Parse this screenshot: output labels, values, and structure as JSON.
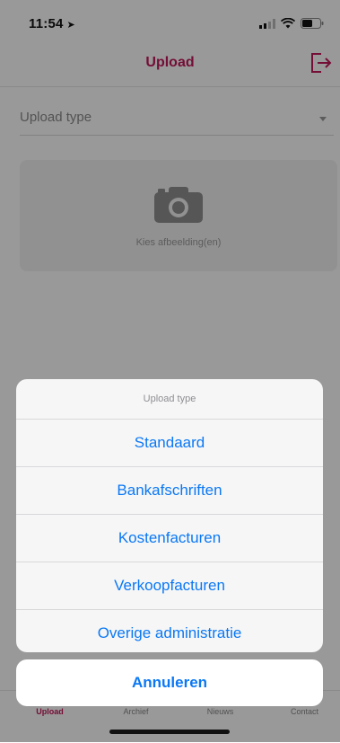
{
  "status_bar": {
    "time": "11:54",
    "location_icon": "location-arrow-icon",
    "icons": [
      "cellular-signal-icon",
      "wifi-icon",
      "battery-icon"
    ]
  },
  "nav": {
    "title": "Upload",
    "logout_icon": "logout-icon"
  },
  "form": {
    "upload_type_label": "Upload type",
    "image_picker_text": "Kies afbeelding(en)",
    "camera_icon": "camera-icon"
  },
  "tab_bar": {
    "tabs": [
      {
        "label": "Upload",
        "active": true
      },
      {
        "label": "Archief",
        "active": false
      },
      {
        "label": "Nieuws",
        "active": false
      },
      {
        "label": "Contact",
        "active": false
      }
    ]
  },
  "action_sheet": {
    "title": "Upload type",
    "options": [
      "Standaard",
      "Bankafschriften",
      "Kostenfacturen",
      "Verkoopfacturen",
      "Overige administratie"
    ],
    "cancel_label": "Annuleren"
  },
  "colors": {
    "accent": "#c2185b",
    "ios_blue": "#0a78f5"
  }
}
